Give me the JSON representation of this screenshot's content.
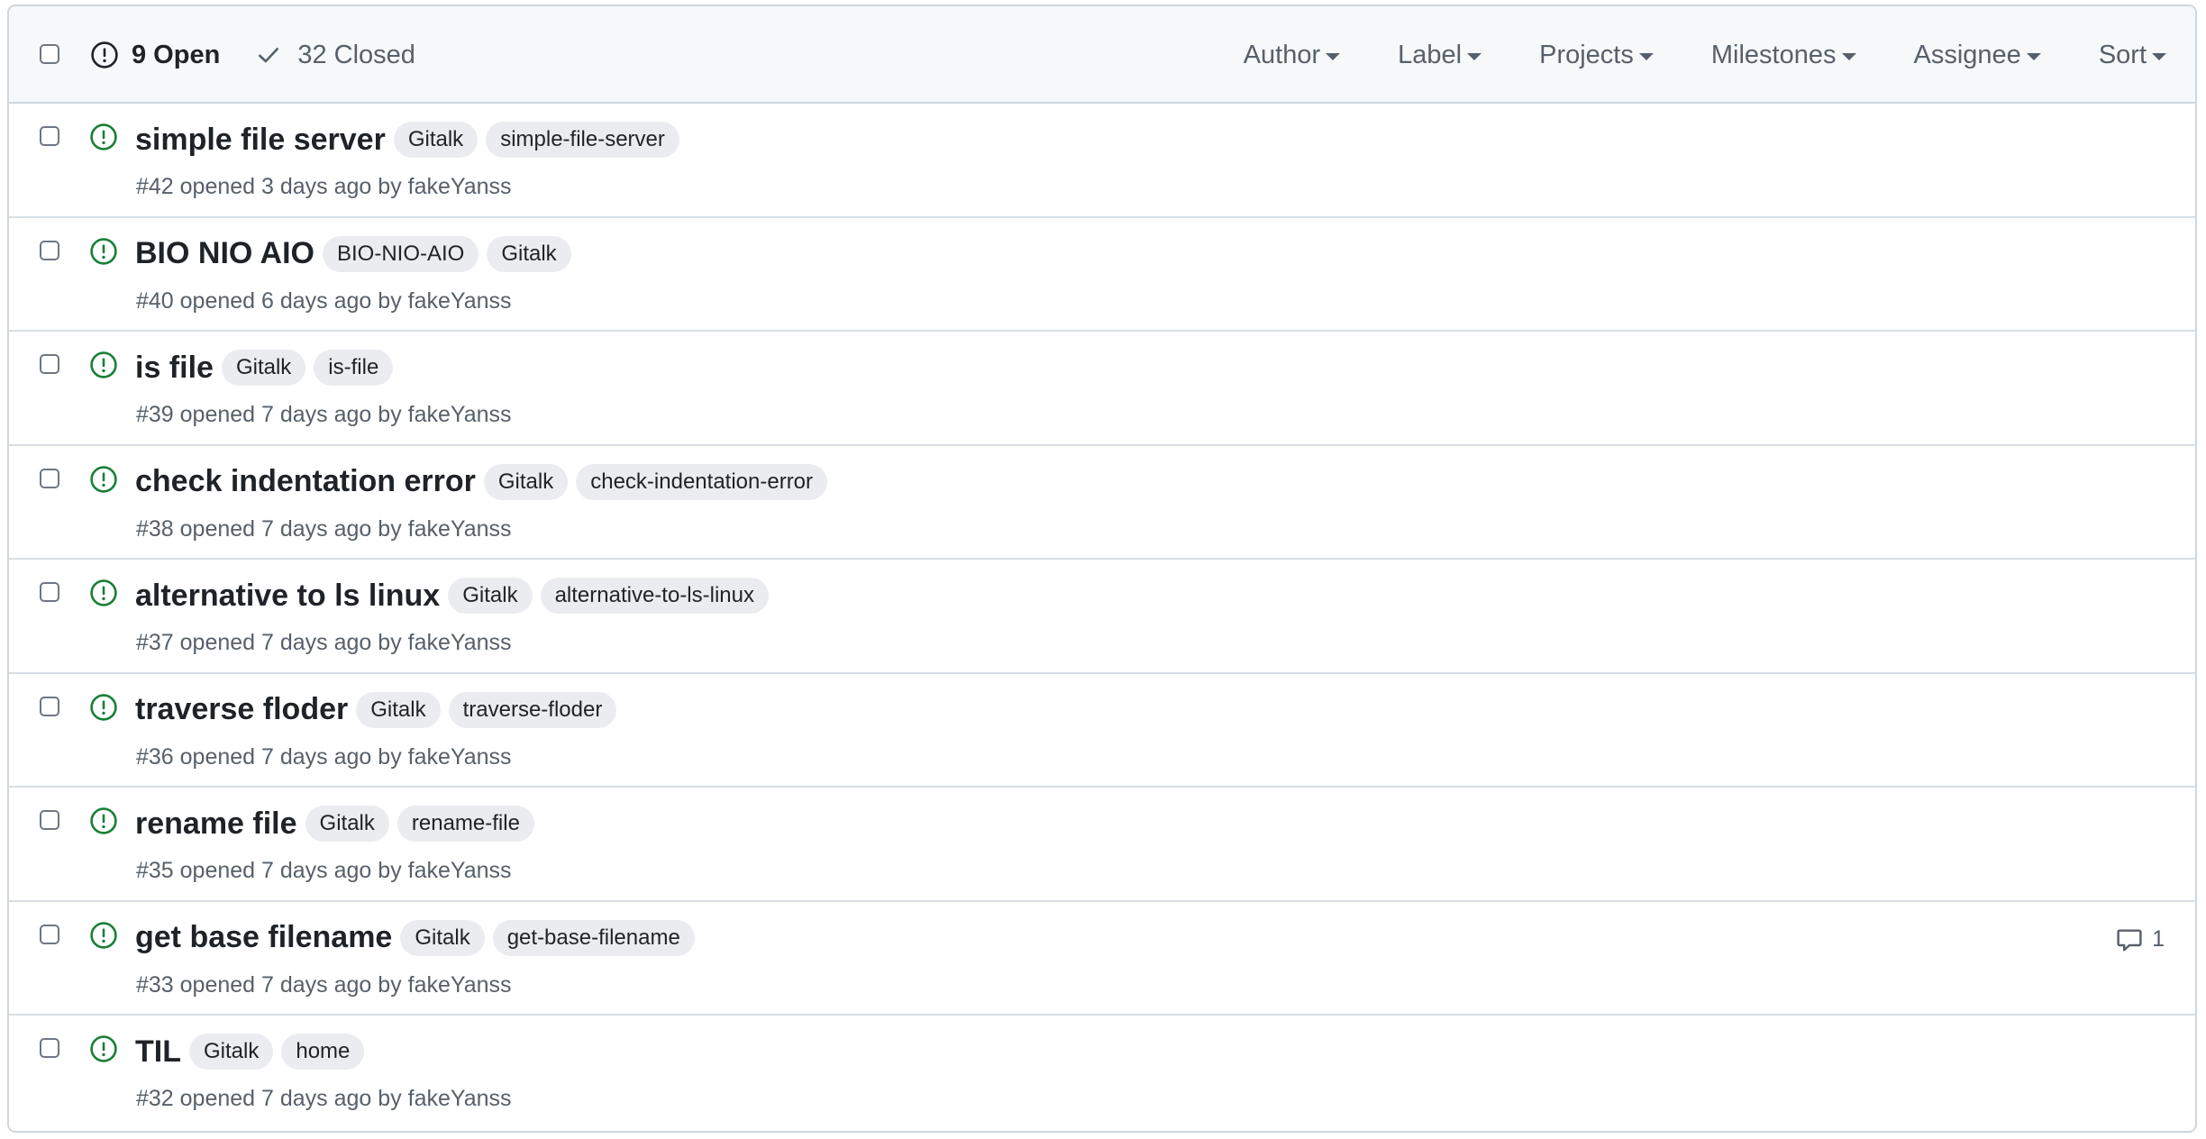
{
  "header": {
    "open_count": "9 Open",
    "closed_count": "32 Closed",
    "filters": [
      "Author",
      "Label",
      "Projects",
      "Milestones",
      "Assignee",
      "Sort"
    ]
  },
  "issues": [
    {
      "title": "simple file server",
      "labels": [
        "Gitalk",
        "simple-file-server"
      ],
      "meta": "#42 opened 3 days ago by fakeYanss",
      "comments": ""
    },
    {
      "title": "BIO NIO AIO",
      "labels": [
        "BIO-NIO-AIO",
        "Gitalk"
      ],
      "meta": "#40 opened 6 days ago by fakeYanss",
      "comments": ""
    },
    {
      "title": "is file",
      "labels": [
        "Gitalk",
        "is-file"
      ],
      "meta": "#39 opened 7 days ago by fakeYanss",
      "comments": ""
    },
    {
      "title": "check indentation error",
      "labels": [
        "Gitalk",
        "check-indentation-error"
      ],
      "meta": "#38 opened 7 days ago by fakeYanss",
      "comments": ""
    },
    {
      "title": "alternative to ls linux",
      "labels": [
        "Gitalk",
        "alternative-to-ls-linux"
      ],
      "meta": "#37 opened 7 days ago by fakeYanss",
      "comments": ""
    },
    {
      "title": "traverse floder",
      "labels": [
        "Gitalk",
        "traverse-floder"
      ],
      "meta": "#36 opened 7 days ago by fakeYanss",
      "comments": ""
    },
    {
      "title": "rename file",
      "labels": [
        "Gitalk",
        "rename-file"
      ],
      "meta": "#35 opened 7 days ago by fakeYanss",
      "comments": ""
    },
    {
      "title": "get base filename",
      "labels": [
        "Gitalk",
        "get-base-filename"
      ],
      "meta": "#33 opened 7 days ago by fakeYanss",
      "comments": "1"
    },
    {
      "title": "TIL",
      "labels": [
        "Gitalk",
        "home"
      ],
      "meta": "#32 opened 7 days ago by fakeYanss",
      "comments": ""
    }
  ],
  "colors": {
    "open_icon": "#1a7f37",
    "label_bg": "#ebecf0",
    "muted_text": "#57606a",
    "border": "#d0d7de"
  },
  "icons": {
    "open": "issue-opened-icon",
    "closed": "check-icon",
    "comment": "comment-icon"
  }
}
